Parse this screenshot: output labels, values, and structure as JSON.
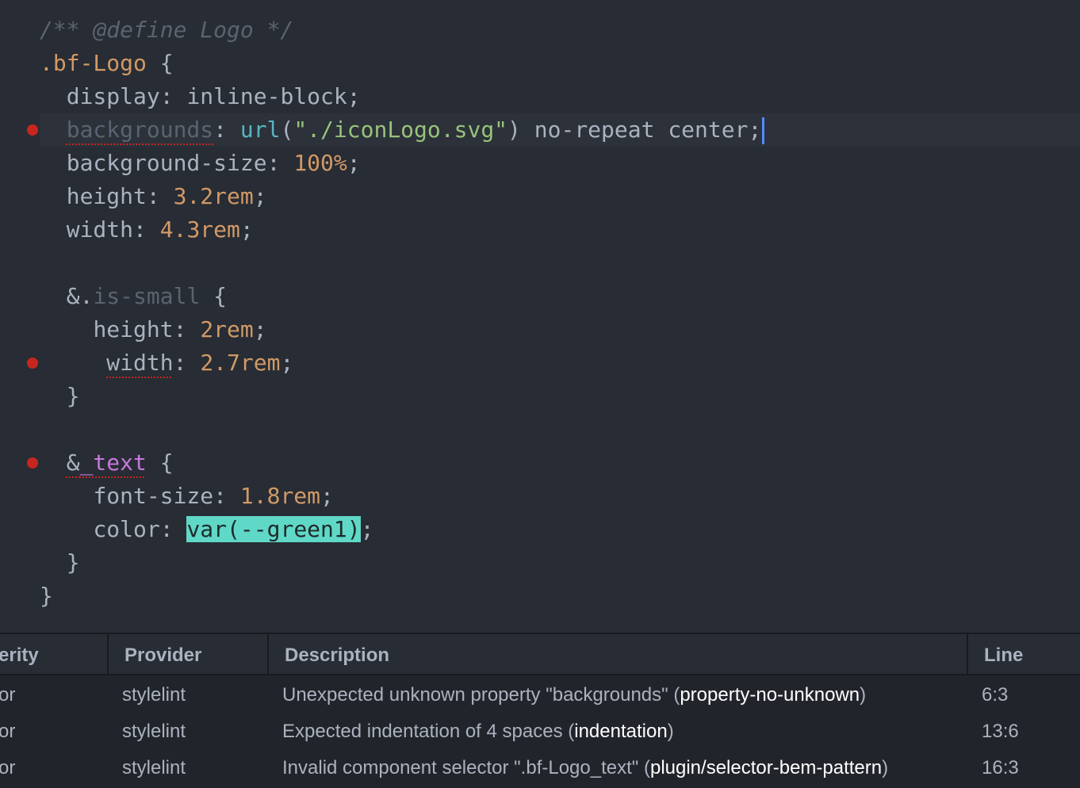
{
  "editor": {
    "lines": [
      {
        "indent": "",
        "parts": [
          {
            "t": "/** @define Logo */",
            "c": "cm"
          }
        ]
      },
      {
        "indent": "",
        "parts": [
          {
            "t": ".bf-Logo",
            "c": "sel"
          },
          {
            "t": " {",
            "c": "kw"
          }
        ]
      },
      {
        "indent": "  ",
        "parts": [
          {
            "t": "display",
            "c": "prop"
          },
          {
            "t": ": inline-block;",
            "c": "kw"
          }
        ]
      },
      {
        "indent": "  ",
        "current": true,
        "error": true,
        "parts": [
          {
            "t": "backgrounds",
            "c": "cls err"
          },
          {
            "t": ": ",
            "c": "kw"
          },
          {
            "t": "url",
            "c": "fn"
          },
          {
            "t": "(",
            "c": "kw"
          },
          {
            "t": "\"./iconLogo.svg\"",
            "c": "str"
          },
          {
            "t": ") no-repeat center;",
            "c": "kw"
          }
        ]
      },
      {
        "indent": "  ",
        "parts": [
          {
            "t": "background-size",
            "c": "prop"
          },
          {
            "t": ": ",
            "c": "kw"
          },
          {
            "t": "100%",
            "c": "num"
          },
          {
            "t": ";",
            "c": "kw"
          }
        ]
      },
      {
        "indent": "  ",
        "parts": [
          {
            "t": "height",
            "c": "prop"
          },
          {
            "t": ": ",
            "c": "kw"
          },
          {
            "t": "3.2rem",
            "c": "num"
          },
          {
            "t": ";",
            "c": "kw"
          }
        ]
      },
      {
        "indent": "  ",
        "parts": [
          {
            "t": "width",
            "c": "prop"
          },
          {
            "t": ": ",
            "c": "kw"
          },
          {
            "t": "4.3rem",
            "c": "num"
          },
          {
            "t": ";",
            "c": "kw"
          }
        ]
      },
      {
        "indent": "",
        "parts": []
      },
      {
        "indent": "  ",
        "parts": [
          {
            "t": "&.",
            "c": "kw"
          },
          {
            "t": "is-small",
            "c": "cls"
          },
          {
            "t": " {",
            "c": "kw"
          }
        ]
      },
      {
        "indent": "    ",
        "parts": [
          {
            "t": "height",
            "c": "prop"
          },
          {
            "t": ": ",
            "c": "kw"
          },
          {
            "t": "2rem",
            "c": "num"
          },
          {
            "t": ";",
            "c": "kw"
          }
        ]
      },
      {
        "indent": "     ",
        "error": true,
        "parts": [
          {
            "t": "width",
            "c": "prop err"
          },
          {
            "t": ": ",
            "c": "kw"
          },
          {
            "t": "2.7rem",
            "c": "num"
          },
          {
            "t": ";",
            "c": "kw"
          }
        ]
      },
      {
        "indent": "  ",
        "parts": [
          {
            "t": "}",
            "c": "kw"
          }
        ]
      },
      {
        "indent": "",
        "parts": []
      },
      {
        "indent": "  ",
        "error": true,
        "parts": [
          {
            "t": "&",
            "c": "kw err"
          },
          {
            "t": "_text",
            "c": "mag err"
          },
          {
            "t": " {",
            "c": "kw"
          }
        ]
      },
      {
        "indent": "    ",
        "parts": [
          {
            "t": "font-size",
            "c": "prop"
          },
          {
            "t": ": ",
            "c": "kw"
          },
          {
            "t": "1.8rem",
            "c": "num"
          },
          {
            "t": ";",
            "c": "kw"
          }
        ]
      },
      {
        "indent": "    ",
        "parts": [
          {
            "t": "color",
            "c": "prop"
          },
          {
            "t": ": ",
            "c": "kw"
          },
          {
            "t": "var(--green1)",
            "c": "hl"
          },
          {
            "t": ";",
            "c": "kw"
          }
        ]
      },
      {
        "indent": "  ",
        "parts": [
          {
            "t": "}",
            "c": "kw"
          }
        ]
      },
      {
        "indent": "",
        "parts": [
          {
            "t": "}",
            "c": "kw"
          }
        ]
      }
    ]
  },
  "panel": {
    "headers": {
      "severity": "erity",
      "provider": "Provider",
      "description": "Description",
      "line": "Line"
    },
    "rows": [
      {
        "severity": "or",
        "provider": "stylelint",
        "desc_prefix": "Unexpected unknown property \"backgrounds\" (",
        "rule": "property-no-unknown",
        "desc_suffix": ")",
        "line": "6:3"
      },
      {
        "severity": "or",
        "provider": "stylelint",
        "desc_prefix": "Expected indentation of 4 spaces (",
        "rule": "indentation",
        "desc_suffix": ")",
        "line": "13:6"
      },
      {
        "severity": "or",
        "provider": "stylelint",
        "desc_prefix": "Invalid component selector \".bf-Logo_text\" (",
        "rule": "plugin/selector-bem-pattern",
        "desc_suffix": ")",
        "line": "16:3"
      }
    ]
  },
  "colors": {
    "background": "#282c34",
    "error_dot": "#c7261f",
    "highlight": "#5fd8c7",
    "cursor": "#528bff"
  }
}
